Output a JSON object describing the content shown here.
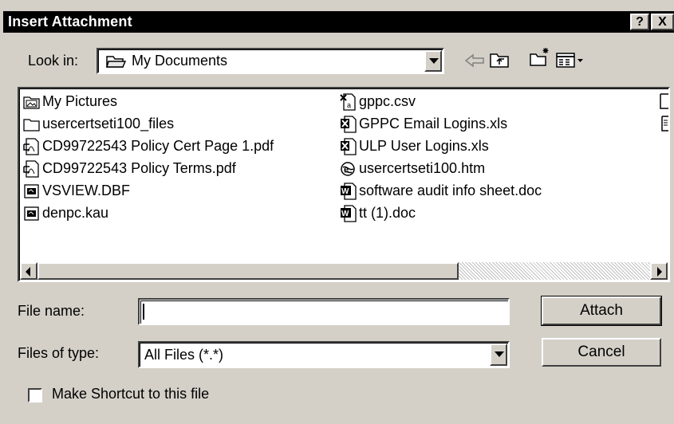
{
  "window": {
    "title": "Insert Attachment",
    "help_label": "?",
    "close_label": "X"
  },
  "look_in": {
    "label": "Look in:",
    "value": "My Documents"
  },
  "files": [
    {
      "name": "My Pictures",
      "icon": "pictures-folder-icon"
    },
    {
      "name": "usercertseti100_files",
      "icon": "folder-icon"
    },
    {
      "name": "CD99722543 Policy Cert Page 1.pdf",
      "icon": "pdf-file-icon"
    },
    {
      "name": "CD99722543 Policy Terms.pdf",
      "icon": "pdf-file-icon"
    },
    {
      "name": "VSVIEW.DBF",
      "icon": "generic-file-icon"
    },
    {
      "name": "denpc.kau",
      "icon": "generic-file-icon"
    },
    {
      "name": "gppc.csv",
      "icon": "csv-file-icon"
    },
    {
      "name": "GPPC Email Logins.xls",
      "icon": "excel-file-icon"
    },
    {
      "name": "ULP User Logins.xls",
      "icon": "excel-file-icon"
    },
    {
      "name": "usercertseti100.htm",
      "icon": "html-file-icon"
    },
    {
      "name": "software audit info sheet.doc",
      "icon": "word-file-icon"
    },
    {
      "name": "tt (1).doc",
      "icon": "word-file-icon"
    }
  ],
  "file_name": {
    "label": "File name:",
    "value": ""
  },
  "file_type": {
    "label": "Files of type:",
    "value": "All Files (*.*)"
  },
  "buttons": {
    "attach": "Attach",
    "cancel": "Cancel"
  },
  "shortcut": {
    "label": "Make Shortcut to this file",
    "checked": false
  }
}
